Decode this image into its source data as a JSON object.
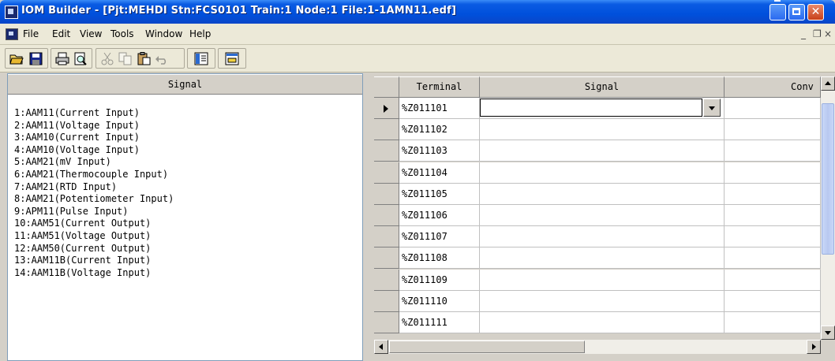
{
  "window": {
    "title": "IOM Builder - [Pjt:MEHDI Stn:FCS0101 Train:1 Node:1 File:1-1AMN11.edf]"
  },
  "menu": {
    "items": [
      "File",
      "Edit",
      "View",
      "Tools",
      "Window",
      "Help"
    ],
    "mdi_minimize": "_",
    "mdi_restore": "❐",
    "mdi_close": "×"
  },
  "toolbar": {
    "icons": [
      "open-folder-icon",
      "save-icon",
      "print-icon",
      "print-preview-icon",
      "cut-icon",
      "copy-icon",
      "paste-icon",
      "undo-icon",
      "panel-view-icon",
      "detail-view-icon"
    ]
  },
  "signal_panel": {
    "header": "Signal",
    "items": [
      "1:AAM11(Current Input)",
      "2:AAM11(Voltage Input)",
      "3:AAM10(Current Input)",
      "4:AAM10(Voltage Input)",
      "5:AAM21(mV Input)",
      "6:AAM21(Thermocouple Input)",
      "7:AAM21(RTD Input)",
      "8:AAM21(Potentiometer Input)",
      "9:APM11(Pulse Input)",
      "10:AAM51(Current Output)",
      "11:AAM51(Voltage Output)",
      "12:AAM50(Current Output)",
      "13:AAM11B(Current Input)",
      "14:AAM11B(Voltage Input)"
    ]
  },
  "grid": {
    "columns": [
      "Terminal",
      "Signal",
      "Conv"
    ],
    "rows": [
      {
        "terminal": "%Z011101",
        "signal": "",
        "conv": ""
      },
      {
        "terminal": "%Z011102",
        "signal": "",
        "conv": ""
      },
      {
        "terminal": "%Z011103",
        "signal": "",
        "conv": ""
      },
      {
        "terminal": "%Z011104",
        "signal": "",
        "conv": ""
      },
      {
        "terminal": "%Z011105",
        "signal": "",
        "conv": ""
      },
      {
        "terminal": "%Z011106",
        "signal": "",
        "conv": ""
      },
      {
        "terminal": "%Z011107",
        "signal": "",
        "conv": ""
      },
      {
        "terminal": "%Z011108",
        "signal": "",
        "conv": ""
      },
      {
        "terminal": "%Z011109",
        "signal": "",
        "conv": ""
      },
      {
        "terminal": "%Z011110",
        "signal": "",
        "conv": ""
      },
      {
        "terminal": "%Z011111",
        "signal": "",
        "conv": ""
      }
    ],
    "current_row_index": 0
  },
  "colors": {
    "titlebar": "#0050dc",
    "chrome": "#ece9d8",
    "panel_header": "#d4d0c8"
  }
}
